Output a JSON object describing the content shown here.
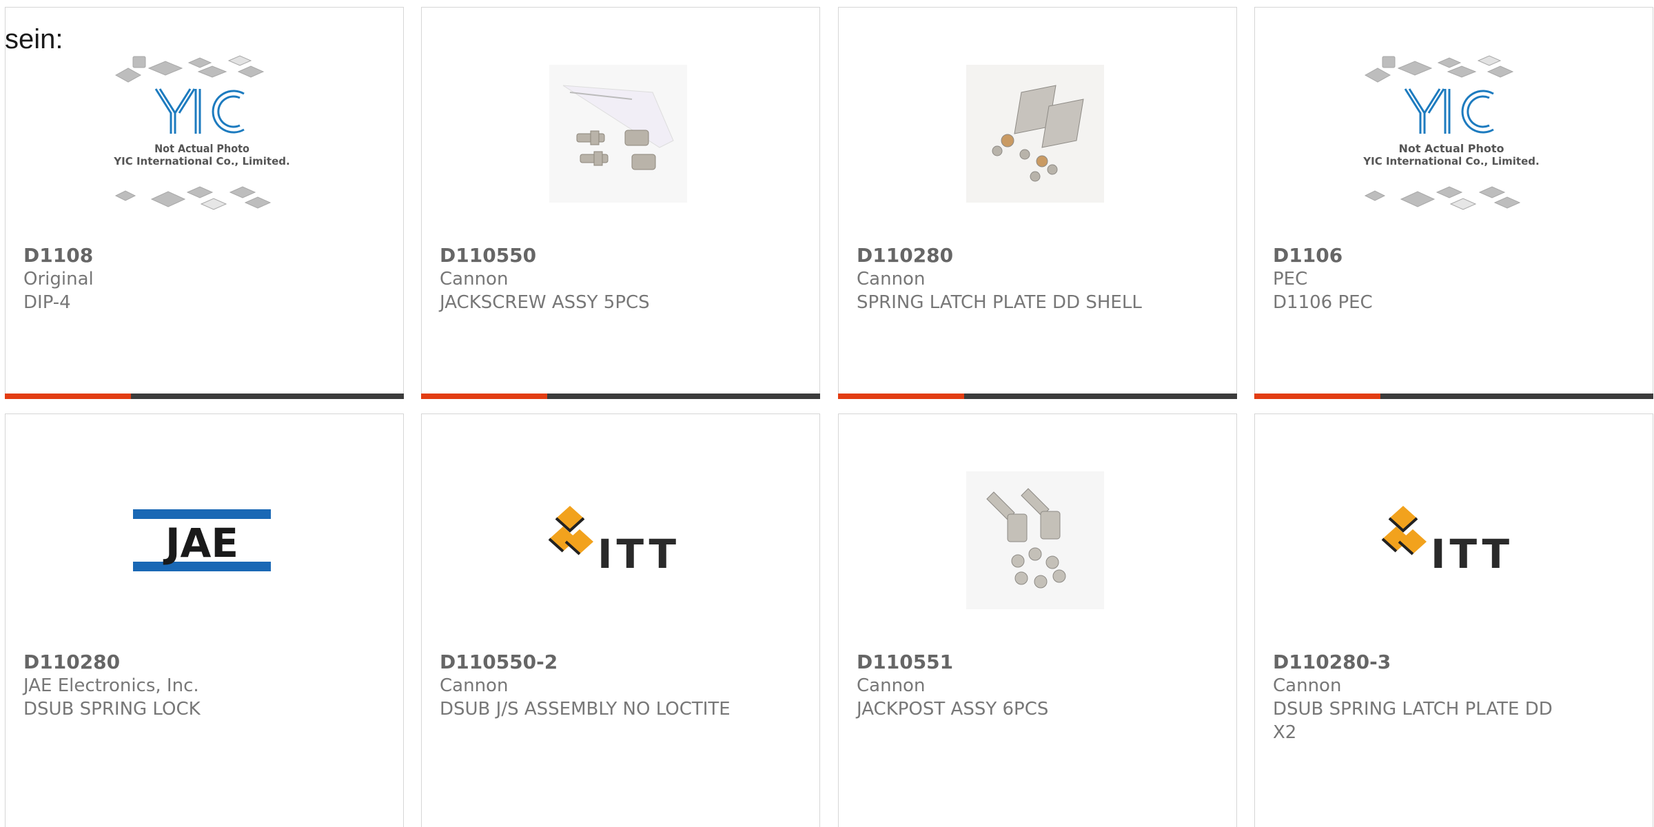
{
  "heading": "sein:",
  "colors": {
    "accent": "#e23d12",
    "bar": "#3c3c3c",
    "itt_orange": "#f2a21d",
    "jae_blue": "#1a68b5"
  },
  "products": [
    {
      "part": "D1108",
      "manufacturer": "Original",
      "description": "DIP-4",
      "image": "yic-placeholder",
      "photo_caption_1": "Not Actual Photo",
      "photo_caption_2": "YIC International Co., Limited.",
      "logo_text": "YIC"
    },
    {
      "part": "D110550",
      "manufacturer": "Cannon",
      "description": "JACKSCREW ASSY 5PCS",
      "image": "jackscrew-photo"
    },
    {
      "part": "D110280",
      "manufacturer": "Cannon",
      "description": "SPRING LATCH PLATE DD SHELL",
      "image": "latch-plate-photo"
    },
    {
      "part": "D1106",
      "manufacturer": "PEC",
      "description": "D1106 PEC",
      "image": "yic-placeholder",
      "photo_caption_1": "Not Actual Photo",
      "photo_caption_2": "YIC International Co., Limited.",
      "logo_text": "YIC"
    },
    {
      "part": "D110280",
      "manufacturer": "JAE Electronics, Inc.",
      "description": "DSUB SPRING LOCK",
      "image": "jae-logo",
      "logo_text": "JAE"
    },
    {
      "part": "D110550-2",
      "manufacturer": "Cannon",
      "description": "DSUB J/S ASSEMBLY NO LOCTITE",
      "image": "itt-logo",
      "logo_text": "ITT"
    },
    {
      "part": "D110551",
      "manufacturer": "Cannon",
      "description": "JACKPOST ASSY 6PCS",
      "image": "jackpost-photo"
    },
    {
      "part": "D110280-3",
      "manufacturer": "Cannon",
      "description": "DSUB SPRING LATCH PLATE DD X2",
      "image": "itt-logo",
      "logo_text": "ITT"
    }
  ]
}
